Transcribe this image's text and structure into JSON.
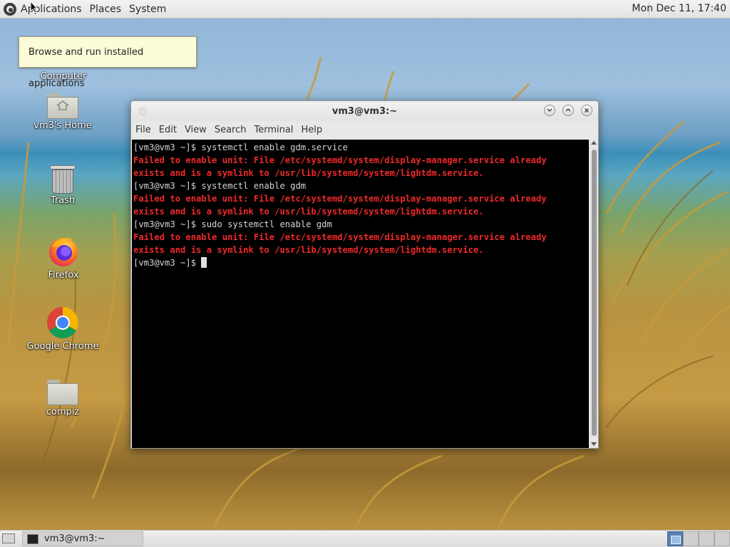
{
  "top_panel": {
    "menus": [
      "Applications",
      "Places",
      "System"
    ],
    "clock": "Mon Dec 11, 17:40"
  },
  "tooltip": "Browse and run installed applications",
  "desktop_icons": [
    {
      "label": "Computer",
      "icon": "computer-icon"
    },
    {
      "label": "vm3's Home",
      "icon": "home-folder-icon"
    },
    {
      "label": "Trash",
      "icon": "trash-icon"
    },
    {
      "label": "Firefox",
      "icon": "firefox-icon"
    },
    {
      "label": "Google Chrome",
      "icon": "chrome-icon"
    },
    {
      "label": "compiz",
      "icon": "folder-icon"
    }
  ],
  "terminal": {
    "title": "vm3@vm3:~",
    "menu": [
      "File",
      "Edit",
      "View",
      "Search",
      "Terminal",
      "Help"
    ],
    "lines": [
      {
        "type": "prompt",
        "text": "[vm3@vm3 ~]$ systemctl enable gdm.service"
      },
      {
        "type": "error",
        "text": "Failed to enable unit: File /etc/systemd/system/display-manager.service already"
      },
      {
        "type": "error",
        "text": "exists and is a symlink to /usr/lib/systemd/system/lightdm.service."
      },
      {
        "type": "prompt",
        "text": "[vm3@vm3 ~]$ systemctl enable gdm"
      },
      {
        "type": "error",
        "text": "Failed to enable unit: File /etc/systemd/system/display-manager.service already"
      },
      {
        "type": "error",
        "text": "exists and is a symlink to /usr/lib/systemd/system/lightdm.service."
      },
      {
        "type": "prompt",
        "text": "[vm3@vm3 ~]$ sudo systemctl enable gdm"
      },
      {
        "type": "error",
        "text": "Failed to enable unit: File /etc/systemd/system/display-manager.service already"
      },
      {
        "type": "error",
        "text": "exists and is a symlink to /usr/lib/systemd/system/lightdm.service."
      }
    ],
    "current_prompt": "[vm3@vm3 ~]$ "
  },
  "taskbar": {
    "tasks": [
      {
        "label": "vm3@vm3:~",
        "active": true
      }
    ],
    "workspaces": 4,
    "active_workspace": 1
  },
  "colors": {
    "error_text": "#ef2929",
    "terminal_bg": "#000000",
    "terminal_fg": "#d4d4d4",
    "tooltip_bg": "#fbfbd7"
  }
}
